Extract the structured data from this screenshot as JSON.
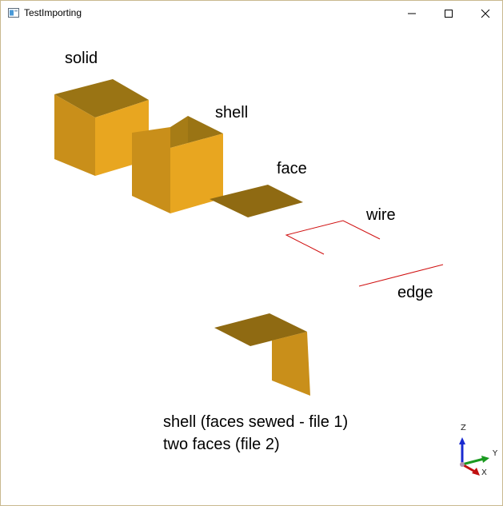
{
  "window": {
    "title": "TestImporting",
    "controls": {
      "minimize_icon": "minimize-icon",
      "maximize_icon": "maximize-icon",
      "close_icon": "close-icon"
    }
  },
  "scene": {
    "labels": {
      "solid": "solid",
      "shell": "shell",
      "face": "face",
      "wire": "wire",
      "edge": "edge"
    },
    "caption": {
      "line1": "shell (faces sewed - file 1)",
      "line2": "two faces (file 2)"
    },
    "colors": {
      "top": "#9a7414",
      "front": "#e8a620",
      "side": "#c98f1a",
      "face": "#8f6a12",
      "wire": "#d01010"
    }
  },
  "axis_triad": {
    "z": "Z",
    "y": "Y",
    "x": "X"
  }
}
